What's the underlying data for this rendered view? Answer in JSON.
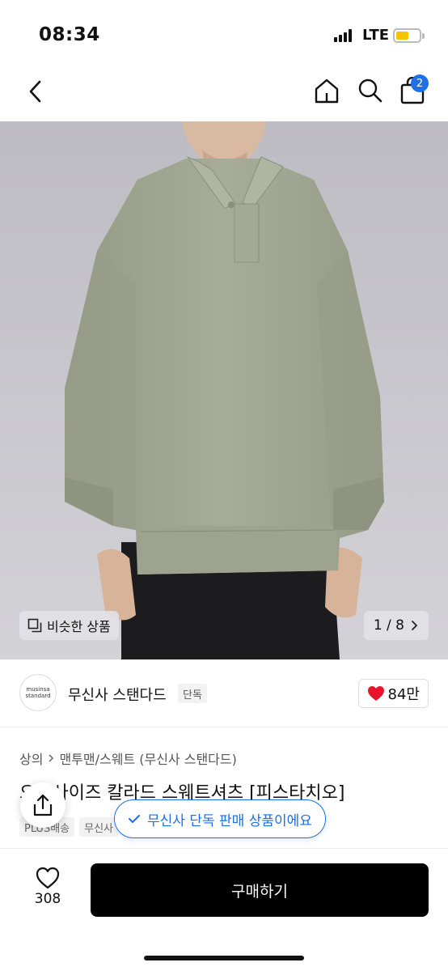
{
  "status": {
    "time": "08:34",
    "network": "LTE"
  },
  "nav": {
    "cart_count": "2"
  },
  "image": {
    "similar_label": "비슷한 상품",
    "counter": "1 / 8"
  },
  "brand": {
    "logo_line1": "musinsa",
    "logo_line2": "standard",
    "name": "무신사 스탠다드",
    "tag": "단독",
    "likes": "84만"
  },
  "product": {
    "category": "상의",
    "subcategory": "맨투맨/스웨트 (무신사 스탠다드)",
    "title": "오버사이즈 칼라드 스웨트셔츠 [피스타치오]",
    "tags": [
      "PLUS배송",
      "무신사"
    ]
  },
  "toast": {
    "text": "무신사 단독 판매 상품이에요"
  },
  "bottom": {
    "wish_count": "308",
    "buy_label": "구매하기"
  },
  "colors": {
    "accent": "#1e6fe8",
    "heart": "#e8142c",
    "sweater": "#a3a895",
    "background_photo": "#c9c8ce",
    "battery": "#f5c400"
  },
  "icons": [
    "back-icon",
    "home-icon",
    "search-icon",
    "shopping-bag-icon",
    "similar-icon",
    "chevron-right-icon",
    "heart-icon",
    "share-icon",
    "check-icon"
  ]
}
